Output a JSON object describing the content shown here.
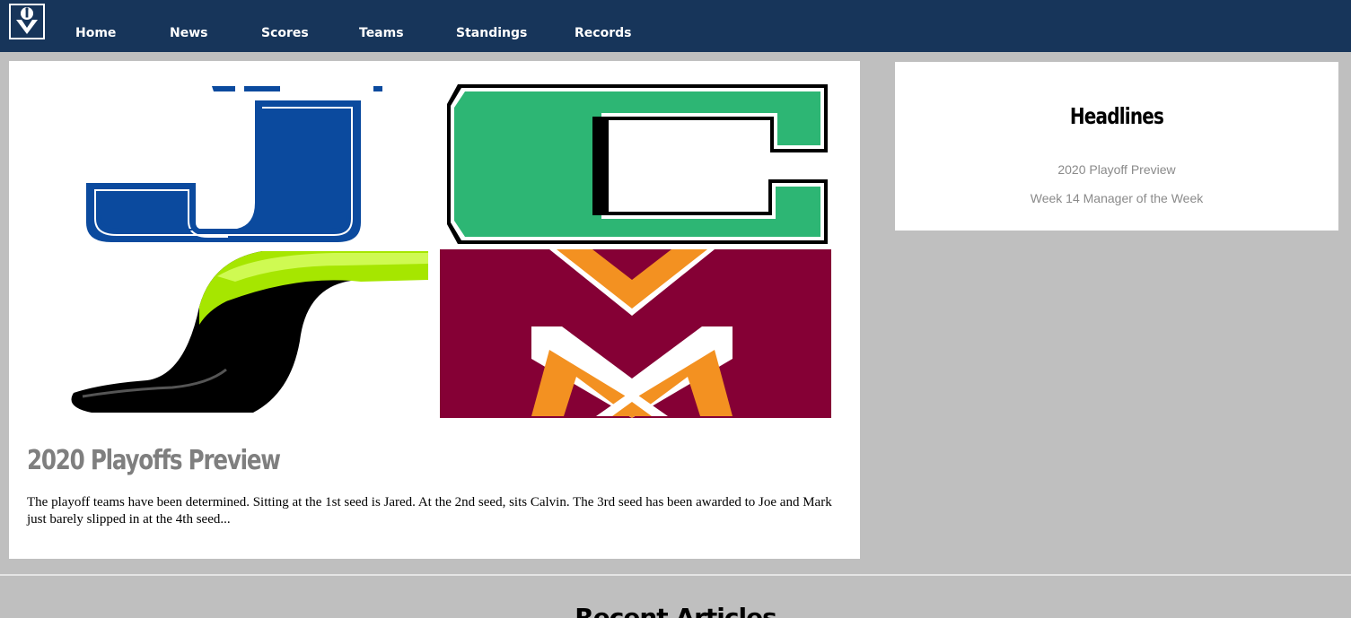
{
  "nav": {
    "logo_icon": "league-shield-logo-icon",
    "items": [
      "Home",
      "News",
      "Scores",
      "Teams",
      "Standings",
      "Records"
    ]
  },
  "feature": {
    "image_icon": "team-logos-collage-icon",
    "title": "2020 Playoffs Preview",
    "text": "The playoff teams have been determined. Sitting at the 1st seed is Jared. At the 2nd seed, sits Calvin. The 3rd seed has been awarded to Joe and Mark just barely slipped in at the 4th seed..."
  },
  "headlines": {
    "title": "Headlines",
    "items": [
      "2020 Playoff Preview",
      "Week 14 Manager of the Week"
    ]
  },
  "recent": {
    "title": "Recent Articles"
  },
  "colors": {
    "nav_background": "#17355a",
    "page_background": "#bfbfbf",
    "j_blue": "#0b4a9e",
    "c_green": "#2db674",
    "maroon": "#850035",
    "orange": "#f39121",
    "lime": "#a6e600"
  }
}
